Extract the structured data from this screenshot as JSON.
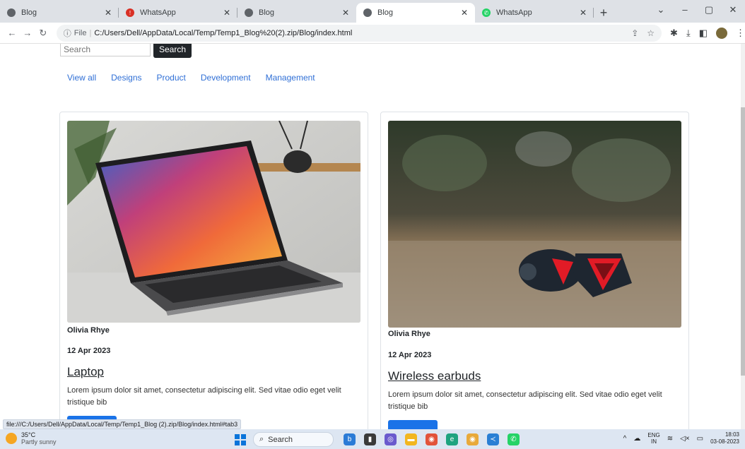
{
  "browser": {
    "tabs": [
      {
        "title": "Blog",
        "favicon": "globe-icon",
        "active": false
      },
      {
        "title": "WhatsApp",
        "favicon": "whatsapp-red-icon",
        "active": false
      },
      {
        "title": "Blog",
        "favicon": "globe-icon",
        "active": false
      },
      {
        "title": "Blog",
        "favicon": "globe-icon",
        "active": true
      },
      {
        "title": "WhatsApp",
        "favicon": "whatsapp-green-icon",
        "active": false
      }
    ],
    "address": {
      "scheme_label": "File",
      "url": "C:/Users/Dell/AppData/Local/Temp/Temp1_Blog%20(2).zip/Blog/index.html"
    },
    "status_url": "file:///C:/Users/Dell/AppData/Local/Temp/Temp1_Blog (2).zip/Blog/index.html#tab3"
  },
  "page": {
    "search": {
      "placeholder": "Search",
      "button_label": "Search"
    },
    "categories": [
      "View all",
      "Designs",
      "Product",
      "Development",
      "Management"
    ],
    "posts": [
      {
        "image_desc": "laptop-photo",
        "author": "Olivia Rhye",
        "date": "12 Apr 2023",
        "title": "Laptop",
        "description": "Lorem ipsum dolor sit amet, consectetur adipiscing elit. Sed vitae odio eget velit tristique bib"
      },
      {
        "image_desc": "earbuds-photo",
        "author": "Olivia Rhye",
        "date": "12 Apr 2023",
        "title": "Wireless earbuds",
        "description": "Lorem ipsum dolor sit amet, consectetur adipiscing elit. Sed vitae odio eget velit tristique bib"
      }
    ]
  },
  "taskbar": {
    "weather": {
      "temp": "35°C",
      "condition": "Partly sunny"
    },
    "search_label": "Search",
    "language": {
      "line1": "ENG",
      "line2": "IN"
    },
    "time": "18:03",
    "date": "03-08-2023"
  },
  "colors": {
    "accent": "#2f6fd6",
    "button_dark": "#212529",
    "read_button": "#1a73e8"
  }
}
